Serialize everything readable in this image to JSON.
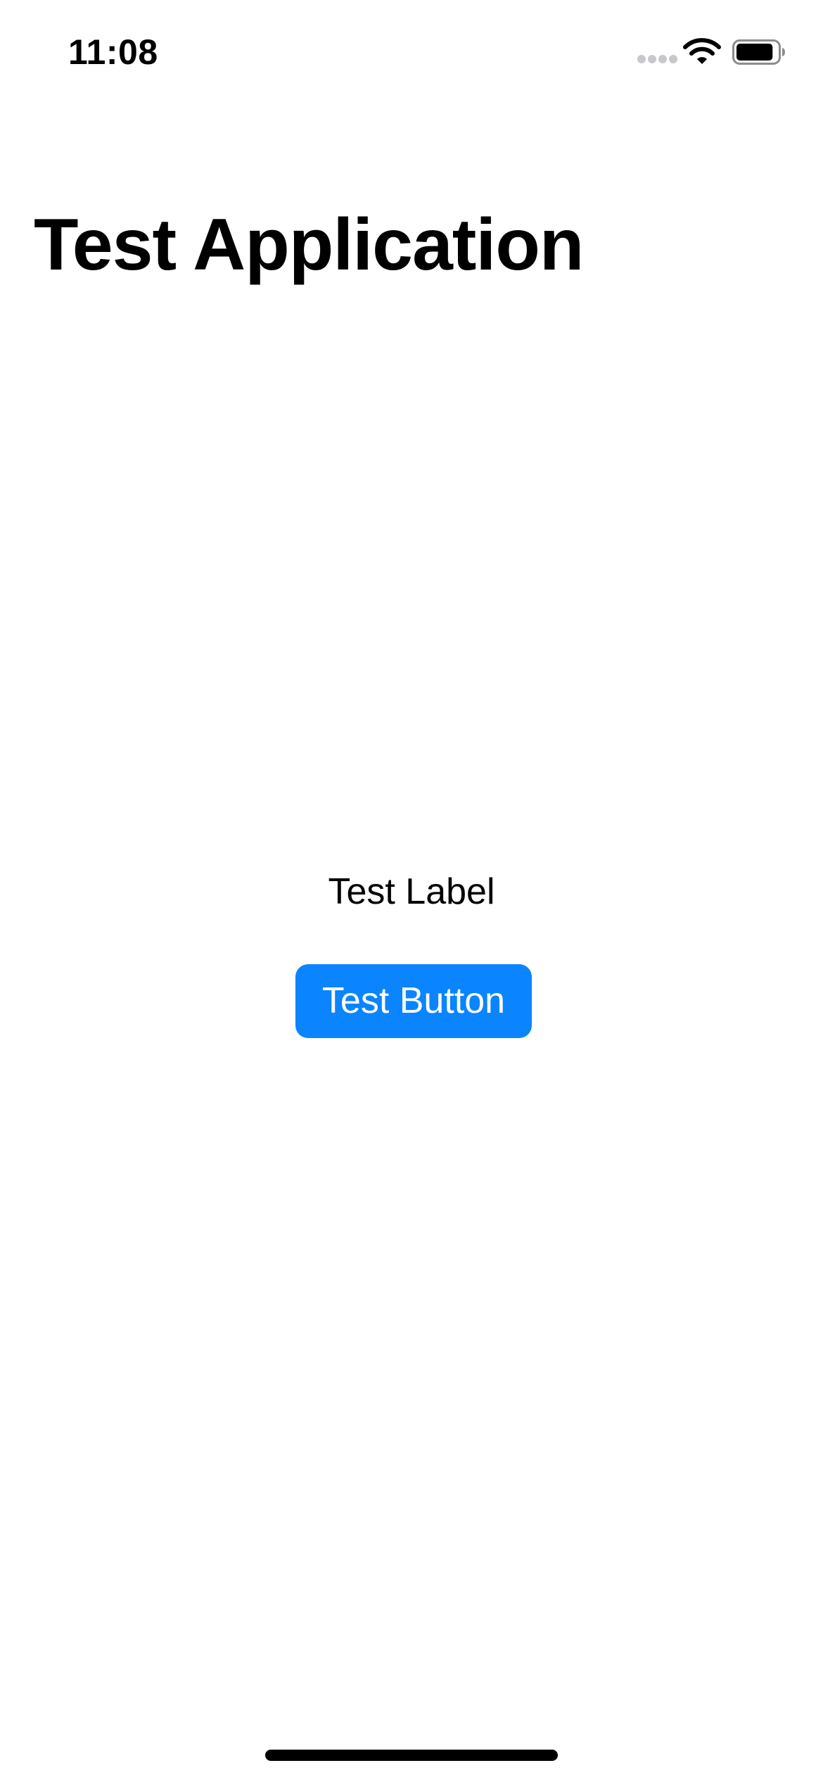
{
  "status_bar": {
    "time": "11:08",
    "signal_icon": "cellular-signal-icon",
    "wifi_icon": "wifi-icon",
    "battery_icon": "battery-icon",
    "battery_level": 0.9
  },
  "screen": {
    "title": "Test Application",
    "label": "Test Label",
    "button_label": "Test Button"
  },
  "colors": {
    "accent": "#0A84FF",
    "text": "#000000",
    "background": "#FFFFFF",
    "inactive_signal": "#C7C7CC"
  }
}
